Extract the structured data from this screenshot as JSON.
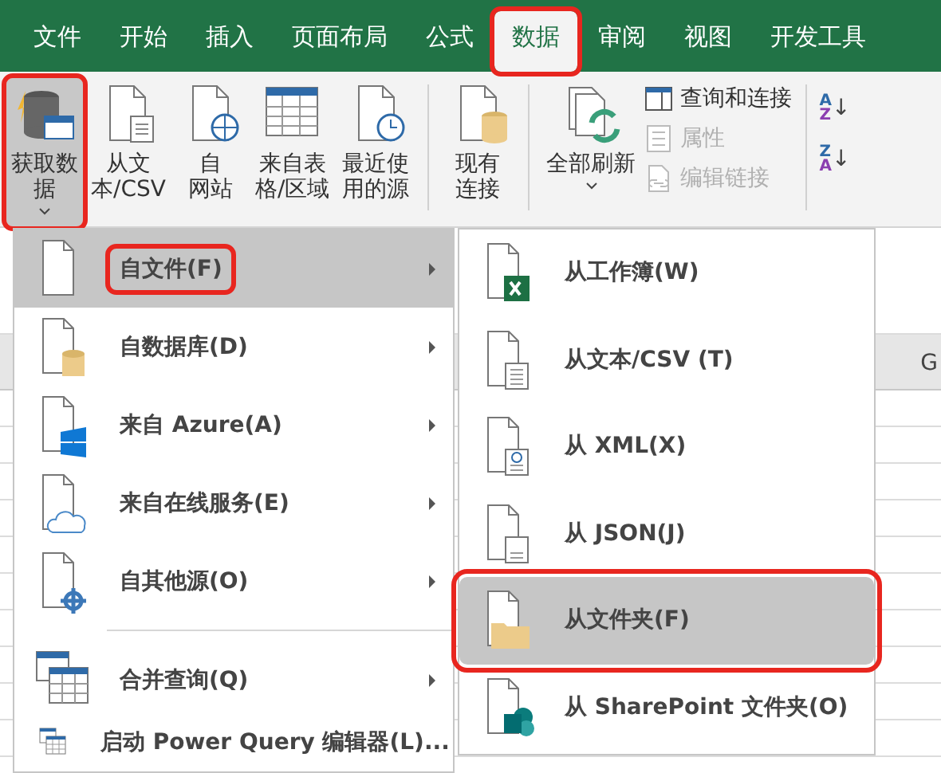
{
  "tabs": [
    {
      "label": "文件",
      "selected": false,
      "highlighted": false
    },
    {
      "label": "开始",
      "selected": false,
      "highlighted": false
    },
    {
      "label": "插入",
      "selected": false,
      "highlighted": false
    },
    {
      "label": "页面布局",
      "selected": false,
      "highlighted": false
    },
    {
      "label": "公式",
      "selected": false,
      "highlighted": false
    },
    {
      "label": "数据",
      "selected": true,
      "highlighted": true
    },
    {
      "label": "审阅",
      "selected": false,
      "highlighted": false
    },
    {
      "label": "视图",
      "selected": false,
      "highlighted": false
    },
    {
      "label": "开发工具",
      "selected": false,
      "highlighted": false
    }
  ],
  "ribbon": {
    "groups": [
      {
        "buttons": [
          {
            "kind": "database",
            "lines": [
              "获取数",
              "据"
            ],
            "dropdown": true,
            "selected": true,
            "highlighted": true
          },
          {
            "kind": "text",
            "lines": [
              "从文",
              "本/CSV"
            ],
            "dropdown": false,
            "selected": false,
            "highlighted": false
          },
          {
            "kind": "web",
            "lines": [
              "自",
              "网站"
            ],
            "dropdown": false,
            "selected": false,
            "highlighted": false
          },
          {
            "kind": "table",
            "lines": [
              "来自表",
              "格/区域"
            ],
            "dropdown": false,
            "selected": false,
            "highlighted": false
          },
          {
            "kind": "recent",
            "lines": [
              "最近使",
              "用的源"
            ],
            "dropdown": false,
            "selected": false,
            "highlighted": false
          }
        ]
      },
      {
        "buttons": [
          {
            "kind": "existing",
            "lines": [
              "现有",
              "连接"
            ],
            "dropdown": false,
            "selected": false,
            "highlighted": false
          }
        ]
      },
      {
        "buttons": [
          {
            "kind": "refresh",
            "lines": [
              "全部刷新"
            ],
            "dropdown": true,
            "selected": false,
            "highlighted": false
          }
        ],
        "small": [
          {
            "kind": "queries",
            "label": "查询和连接",
            "disabled": false
          },
          {
            "kind": "properties",
            "label": "属性",
            "disabled": true
          },
          {
            "kind": "links",
            "label": "编辑链接",
            "disabled": true
          }
        ]
      }
    ],
    "sort": [
      {
        "top": "A",
        "bottom": "Z",
        "arrow": "↓"
      },
      {
        "top": "Z",
        "bottom": "A",
        "arrow": "↓"
      }
    ]
  },
  "sheet": {
    "column_header": "G"
  },
  "menu": {
    "items": [
      {
        "kind": "file",
        "label": "自文件(F)",
        "selected": true,
        "highlighted": true
      },
      {
        "kind": "database",
        "label": "自数据库(D)",
        "selected": false,
        "highlighted": false
      },
      {
        "kind": "azure",
        "label": "来自 Azure(A)",
        "selected": false,
        "highlighted": false
      },
      {
        "kind": "cloud",
        "label": "来自在线服务(E)",
        "selected": false,
        "highlighted": false
      },
      {
        "kind": "other",
        "label": "自其他源(O)",
        "selected": false,
        "highlighted": false
      },
      {
        "kind": "separator"
      },
      {
        "kind": "combine",
        "label": "合并查询(Q)",
        "selected": false,
        "highlighted": false
      },
      {
        "kind": "editor",
        "label": "启动 Power Query 编辑器(L)...",
        "selected": false,
        "highlighted": false
      }
    ]
  },
  "submenu": {
    "items": [
      {
        "kind": "workbook",
        "label": "从工作簿(W)",
        "selected": false,
        "highlighted": false
      },
      {
        "kind": "csv",
        "label": "从文本/CSV (T)",
        "selected": false,
        "highlighted": false
      },
      {
        "kind": "xml",
        "label": "从 XML(X)",
        "selected": false,
        "highlighted": false
      },
      {
        "kind": "json",
        "label": "从 JSON(J)",
        "selected": false,
        "highlighted": false
      },
      {
        "kind": "folder",
        "label": "从文件夹(F)",
        "selected": true,
        "highlighted": true
      },
      {
        "kind": "sharepoint",
        "label": "从 SharePoint 文件夹(O)",
        "selected": false,
        "highlighted": false
      }
    ]
  }
}
